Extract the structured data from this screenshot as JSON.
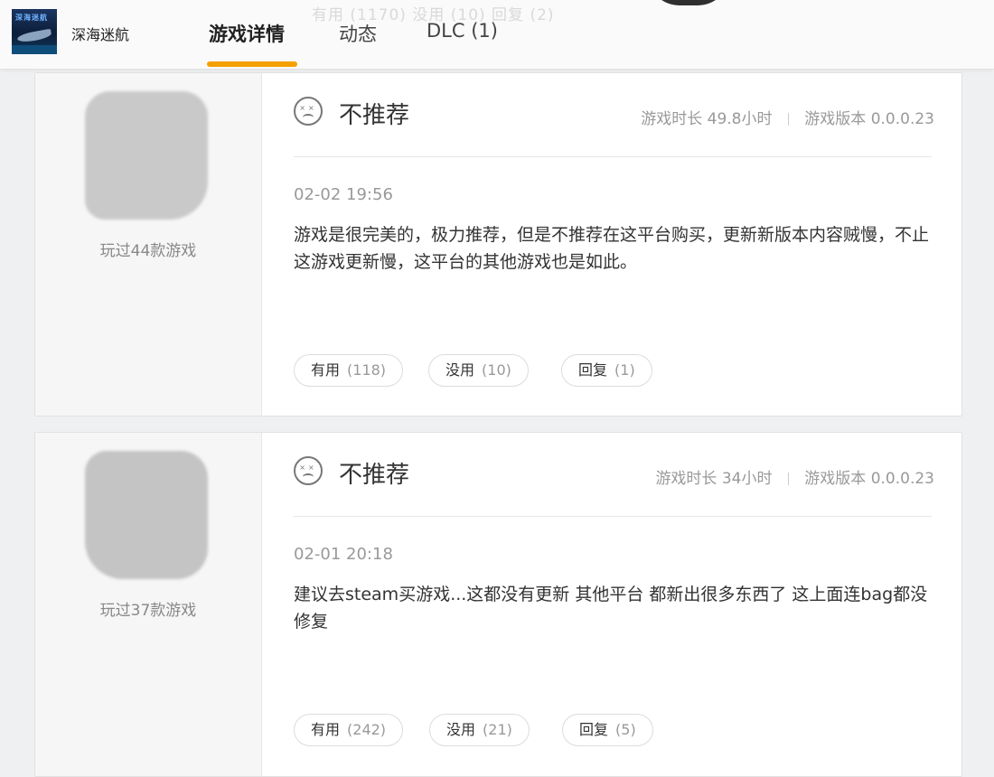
{
  "header": {
    "game_name": "深海迷航",
    "logo_text": "深海迷航",
    "tabs": [
      {
        "label": "游戏详情",
        "active": true
      },
      {
        "label": "动态",
        "active": false
      },
      {
        "label": "DLC (1)",
        "active": false
      }
    ],
    "ghost_text": "有用 (1170)  没用 (10)  回复 (2)",
    "accent_color": "#f4a000"
  },
  "reviews": [
    {
      "played": "玩过44款游戏",
      "verdict": "不推荐",
      "verdict_icon": "sad-face-icon",
      "play_time_label": "游戏时长",
      "play_time": "49.8小时",
      "version_label": "游戏版本",
      "version": "0.0.0.23",
      "date": "02-02 19:56",
      "content": "游戏是很完美的，极力推荐，但是不推荐在这平台购买，更新新版本内容贼慢，不止这游戏更新慢，这平台的其他游戏也是如此。",
      "useful_label": "有用",
      "useful_count": "(118)",
      "useless_label": "没用",
      "useless_count": "(10)",
      "reply_label": "回复",
      "reply_count": "(1)"
    },
    {
      "played": "玩过37款游戏",
      "verdict": "不推荐",
      "verdict_icon": "sad-face-icon",
      "play_time_label": "游戏时长",
      "play_time": "34小时",
      "version_label": "游戏版本",
      "version": "0.0.0.23",
      "date": "02-01 20:18",
      "content": "建议去steam买游戏...这都没有更新 其他平台 都新出很多东西了 这上面连bag都没修复",
      "useful_label": "有用",
      "useful_count": "(242)",
      "useless_label": "没用",
      "useless_count": "(21)",
      "reply_label": "回复",
      "reply_count": "(5)"
    }
  ]
}
